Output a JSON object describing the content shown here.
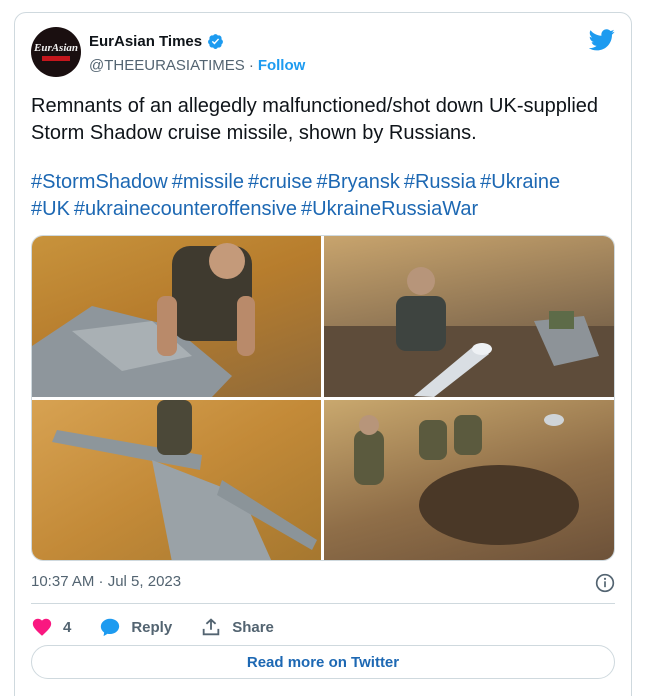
{
  "account": {
    "name": "EurAsian Times",
    "handle": "@THEEURASIATIMES",
    "separator": "·",
    "follow_label": "Follow",
    "avatar_text": "EurAsian",
    "verified": true
  },
  "tweet": {
    "text": "Remnants of an allegedly malfunctioned/shot down UK-supplied Storm Shadow cruise missile, shown by Russians.",
    "hashtags": [
      "#StormShadow",
      "#missile",
      "#cruise",
      "#Bryansk",
      "#Russia",
      "#Ukraine",
      "#UK",
      "#ukrainecounteroffensive",
      "#UkraineRussiaWar"
    ],
    "timestamp": "10:37 AM · Jul 5, 2023"
  },
  "actions": {
    "like_count": "4",
    "reply_label": "Reply",
    "share_label": "Share"
  },
  "read_more_label": "Read more on Twitter",
  "colors": {
    "link": "#1d68b3",
    "twitter_blue": "#1d9bf0",
    "heart": "#f91880",
    "muted": "#536471",
    "border": "#cfd9de"
  },
  "icons": [
    "verified-badge-icon",
    "twitter-bird-icon",
    "info-icon",
    "heart-icon",
    "reply-bubble-icon",
    "share-icon"
  ]
}
